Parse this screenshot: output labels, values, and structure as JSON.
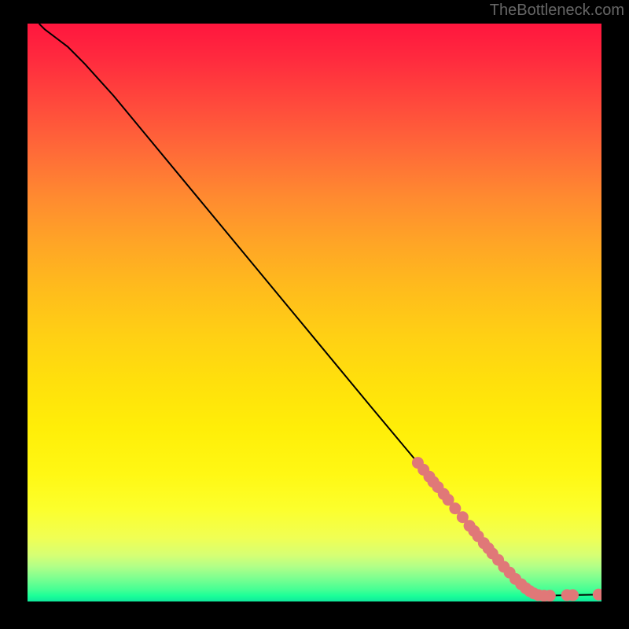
{
  "watermark": "TheBottleneck.com",
  "chart_data": {
    "type": "line",
    "title": "",
    "xlabel": "",
    "ylabel": "",
    "xlim": [
      0,
      100
    ],
    "ylim": [
      0,
      100
    ],
    "curve": [
      {
        "x": 2,
        "y": 100
      },
      {
        "x": 3,
        "y": 99
      },
      {
        "x": 5,
        "y": 97.5
      },
      {
        "x": 7,
        "y": 96
      },
      {
        "x": 10,
        "y": 93
      },
      {
        "x": 15,
        "y": 87.5
      },
      {
        "x": 20,
        "y": 81.5
      },
      {
        "x": 30,
        "y": 69.5
      },
      {
        "x": 40,
        "y": 57.5
      },
      {
        "x": 50,
        "y": 45.5
      },
      {
        "x": 60,
        "y": 33.5
      },
      {
        "x": 68,
        "y": 24
      },
      {
        "x": 75,
        "y": 15.5
      },
      {
        "x": 80,
        "y": 9.5
      },
      {
        "x": 84,
        "y": 5
      },
      {
        "x": 86.5,
        "y": 2.5
      },
      {
        "x": 88,
        "y": 1.5
      },
      {
        "x": 90,
        "y": 1
      },
      {
        "x": 95,
        "y": 1.1
      },
      {
        "x": 100,
        "y": 1.2
      }
    ],
    "markers": [
      {
        "x": 68,
        "y": 24
      },
      {
        "x": 69,
        "y": 22.8
      },
      {
        "x": 70,
        "y": 21.6
      },
      {
        "x": 70.7,
        "y": 20.7
      },
      {
        "x": 71.5,
        "y": 19.8
      },
      {
        "x": 72.5,
        "y": 18.6
      },
      {
        "x": 73.3,
        "y": 17.6
      },
      {
        "x": 74.5,
        "y": 16.1
      },
      {
        "x": 75.8,
        "y": 14.6
      },
      {
        "x": 77,
        "y": 13.1
      },
      {
        "x": 77.8,
        "y": 12.2
      },
      {
        "x": 78.5,
        "y": 11.3
      },
      {
        "x": 79.5,
        "y": 10.1
      },
      {
        "x": 80.3,
        "y": 9.2
      },
      {
        "x": 81,
        "y": 8.3
      },
      {
        "x": 82,
        "y": 7.2
      },
      {
        "x": 83,
        "y": 6
      },
      {
        "x": 84,
        "y": 5
      },
      {
        "x": 85,
        "y": 3.9
      },
      {
        "x": 86,
        "y": 3
      },
      {
        "x": 86.8,
        "y": 2.3
      },
      {
        "x": 87.5,
        "y": 1.8
      },
      {
        "x": 88.2,
        "y": 1.4
      },
      {
        "x": 89,
        "y": 1.1
      },
      {
        "x": 90,
        "y": 1.0
      },
      {
        "x": 91,
        "y": 1.0
      },
      {
        "x": 94,
        "y": 1.1
      },
      {
        "x": 95,
        "y": 1.1
      },
      {
        "x": 99.5,
        "y": 1.2
      }
    ],
    "markerColor": "#e07878",
    "lineColor": "#000000"
  }
}
